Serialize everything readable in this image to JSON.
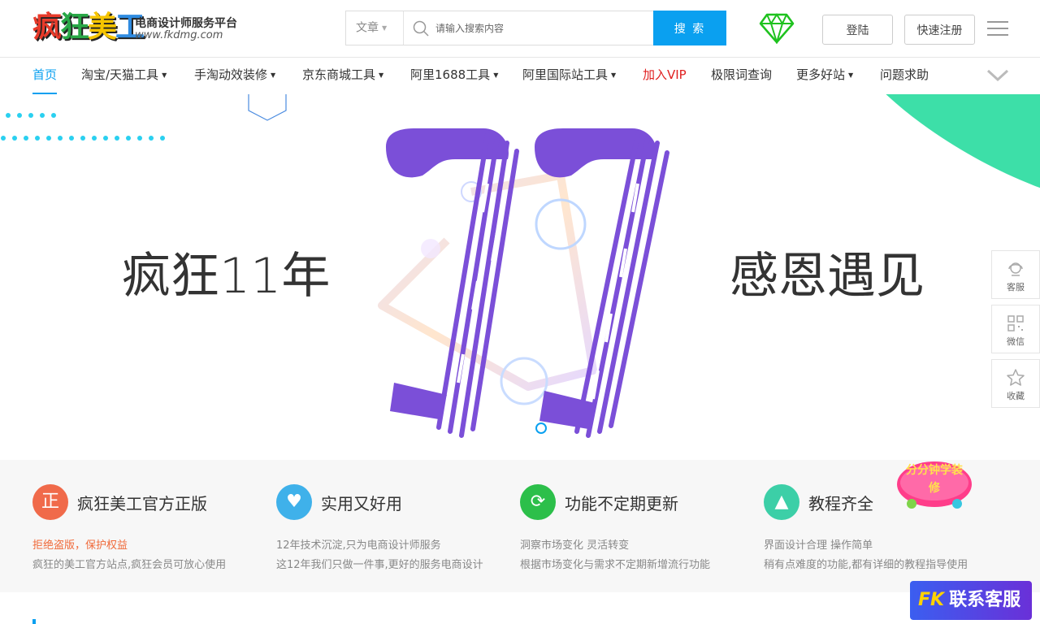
{
  "header": {
    "logo_text": [
      "疯",
      "狂",
      "美",
      "工"
    ],
    "logo_tagline": "电商设计师服务平台",
    "logo_url": "www.fkdmg.com",
    "search": {
      "category": "文章",
      "placeholder": "请输入搜索内容",
      "button_label": "搜 索"
    },
    "vip_icon": "diamond-icon",
    "login_label": "登陆",
    "register_label": "快速注册",
    "menu_icon": "hamburger-icon"
  },
  "nav": {
    "items": [
      {
        "label": "首页",
        "dropdown": false
      },
      {
        "label": "淘宝/天猫工具",
        "dropdown": true
      },
      {
        "label": "手淘动效装修",
        "dropdown": true
      },
      {
        "label": "京东商城工具",
        "dropdown": true
      },
      {
        "label": "阿里1688工具",
        "dropdown": true
      },
      {
        "label": "阿里国际站工具",
        "dropdown": true
      },
      {
        "label": "加入VIP",
        "dropdown": false
      },
      {
        "label": "极限词查询",
        "dropdown": false
      },
      {
        "label": "更多好站",
        "dropdown": true
      },
      {
        "label": "问题求助",
        "dropdown": false
      }
    ],
    "caret": "▼"
  },
  "banner": {
    "left_text": "疯狂11年",
    "right_text": "感恩遇见",
    "slides_shown": 1
  },
  "side_panel": [
    {
      "label": "客服",
      "icon": "headset-icon"
    },
    {
      "label": "微信",
      "icon": "qrcode-icon"
    },
    {
      "label": "收藏",
      "icon": "star-icon"
    }
  ],
  "features": [
    {
      "icon_text": "正",
      "color": "#f06a4a",
      "title": "疯狂美工官方正版",
      "line1": "拒绝盗版，保护权益",
      "line2": "疯狂的美工官方站点,疯狂会员可放心使用"
    },
    {
      "icon_text": "♥",
      "color": "#3fb1ea",
      "title": "实用又好用",
      "line1": "12年技术沉淀,只为电商设计师服务",
      "line2": "这12年我们只做一件事,更好的服务电商设计"
    },
    {
      "icon_text": "⟳",
      "color": "#2cbf4a",
      "title": "功能不定期更新",
      "line1": "洞察市场变化 灵活转变",
      "line2": "根据市场变化与需求不定期新增流行功能"
    },
    {
      "icon_text": "▲",
      "color": "#3ccfa7",
      "title": "教程齐全",
      "line1": "界面设计合理 操作简单",
      "line2": "稍有点难度的功能,都有详细的教程指导使用"
    }
  ],
  "promo": {
    "badge_text": "分分钟学装修",
    "contact_prefix": "FK",
    "contact_label": "联系客服"
  },
  "colors": {
    "accent": "#0aa0f0",
    "vip_red": "#e02020",
    "banner_purple": "#7b4fd8",
    "corner_green": "#3ddfa8"
  }
}
